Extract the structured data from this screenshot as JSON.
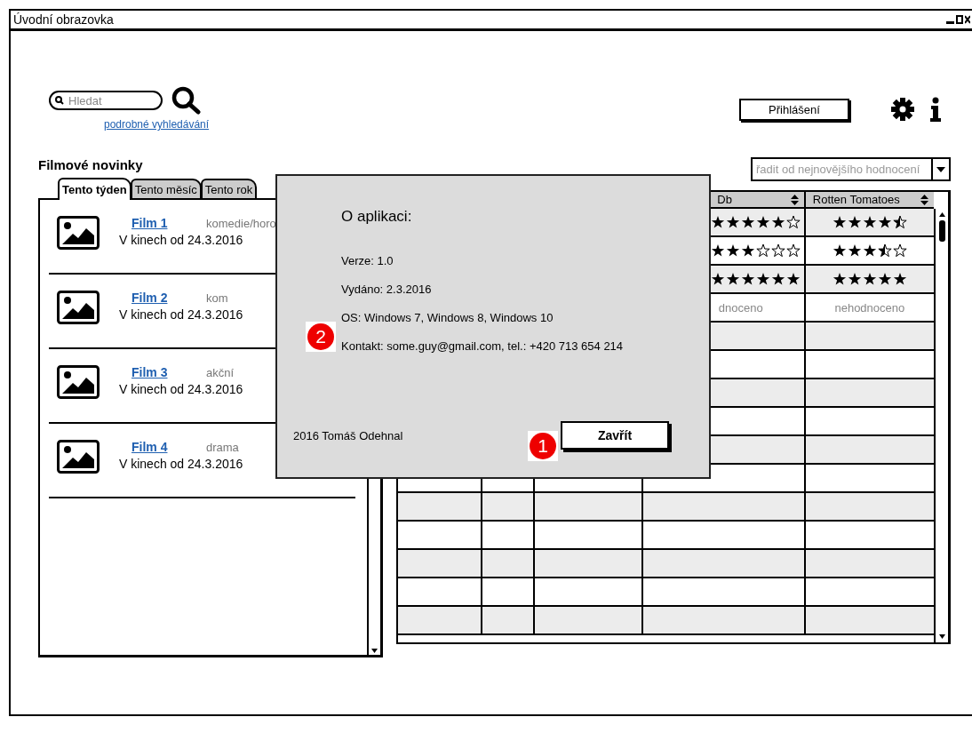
{
  "window": {
    "title": "Úvodní obrazovka"
  },
  "search": {
    "placeholder": "Hledat"
  },
  "advanced_search_link": "podrobné vyhledávání",
  "login_button": "Přihlášení",
  "news": {
    "title": "Filmové novinky",
    "tabs": [
      {
        "label": "Tento týden",
        "selected": true
      },
      {
        "label": "Tento měsíc",
        "selected": false
      },
      {
        "label": "Tento rok",
        "selected": false
      }
    ],
    "films": [
      {
        "title": "Film 1",
        "genre": "komedie/horo",
        "release": "V kinech od 24.3.2016"
      },
      {
        "title": "Film 2",
        "genre": "kom",
        "release": "V kinech od 24.3.2016"
      },
      {
        "title": "Film 3",
        "genre": "akční",
        "release": "V kinech od 24.3.2016"
      },
      {
        "title": "Film 4",
        "genre": "drama",
        "release": "V kinech od 24.3.2016"
      }
    ]
  },
  "ratings": {
    "sort": {
      "placeholder": "řadit od nejnovějšího hodnocení"
    },
    "columns": [
      {
        "label": "Db"
      },
      {
        "label": "Rotten Tomatoes"
      }
    ],
    "rows": [
      {
        "cells": [
          {
            "kind": "stars",
            "stars": 5
          },
          {
            "kind": "stars",
            "stars": 4.5
          }
        ]
      },
      {
        "cells": [
          {
            "kind": "stars",
            "stars": 3
          },
          {
            "kind": "stars",
            "stars": 3.5
          }
        ]
      },
      {
        "cells": [
          {
            "kind": "stars",
            "stars": 6
          },
          {
            "kind": "stars",
            "stars": 5
          }
        ]
      },
      {
        "cells": [
          {
            "kind": "text",
            "text": "dnoceno"
          },
          {
            "kind": "text",
            "text": "nehodnoceno"
          }
        ]
      }
    ]
  },
  "dialog": {
    "title": "O aplikaci:",
    "lines": [
      "Verze: 1.0",
      "Vydáno: 2.3.2016",
      "OS: Windows 7, Windows 8, Windows 10",
      "Kontakt: some.guy@gmail.com, tel.: +420 713 654 214"
    ],
    "footer": "2016 Tomáš Odehnal",
    "button": "Zavřít"
  },
  "markers": [
    {
      "label": "1"
    },
    {
      "label": "2"
    }
  ]
}
